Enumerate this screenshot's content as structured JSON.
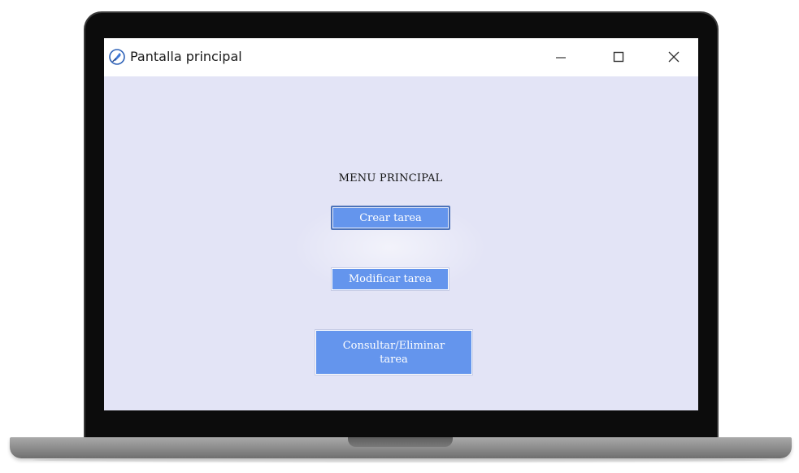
{
  "window": {
    "title": "Pantalla principal",
    "icon": "feather-pen-icon",
    "controls": {
      "minimize": "minimize-icon",
      "maximize": "maximize-icon",
      "close": "close-icon"
    }
  },
  "main": {
    "heading": "MENU PRINCIPAL",
    "buttons": {
      "create": "Crear tarea",
      "modify": "Modificar tarea",
      "query_delete": "Consultar/Eliminar tarea"
    }
  },
  "colors": {
    "background": "#e3e4f6",
    "button": "#6495ed",
    "button_text": "#ffffff",
    "laptop_bezel": "#0c0c0c",
    "laptop_base": "#8a8a8a"
  }
}
